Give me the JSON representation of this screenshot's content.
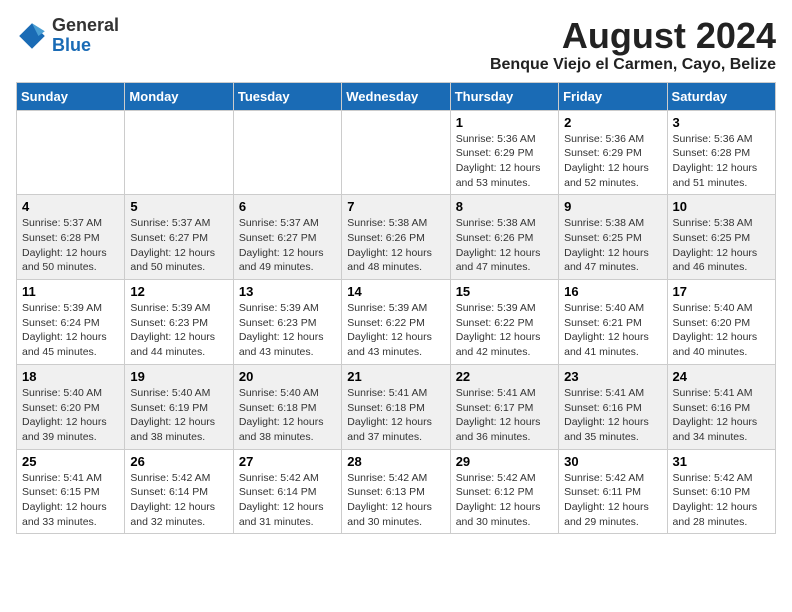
{
  "logo": {
    "text_general": "General",
    "text_blue": "Blue"
  },
  "title": {
    "month_year": "August 2024",
    "location": "Benque Viejo el Carmen, Cayo, Belize"
  },
  "headers": [
    "Sunday",
    "Monday",
    "Tuesday",
    "Wednesday",
    "Thursday",
    "Friday",
    "Saturday"
  ],
  "weeks": [
    [
      {
        "day": "",
        "info": ""
      },
      {
        "day": "",
        "info": ""
      },
      {
        "day": "",
        "info": ""
      },
      {
        "day": "",
        "info": ""
      },
      {
        "day": "1",
        "info": "Sunrise: 5:36 AM\nSunset: 6:29 PM\nDaylight: 12 hours\nand 53 minutes."
      },
      {
        "day": "2",
        "info": "Sunrise: 5:36 AM\nSunset: 6:29 PM\nDaylight: 12 hours\nand 52 minutes."
      },
      {
        "day": "3",
        "info": "Sunrise: 5:36 AM\nSunset: 6:28 PM\nDaylight: 12 hours\nand 51 minutes."
      }
    ],
    [
      {
        "day": "4",
        "info": "Sunrise: 5:37 AM\nSunset: 6:28 PM\nDaylight: 12 hours\nand 50 minutes."
      },
      {
        "day": "5",
        "info": "Sunrise: 5:37 AM\nSunset: 6:27 PM\nDaylight: 12 hours\nand 50 minutes."
      },
      {
        "day": "6",
        "info": "Sunrise: 5:37 AM\nSunset: 6:27 PM\nDaylight: 12 hours\nand 49 minutes."
      },
      {
        "day": "7",
        "info": "Sunrise: 5:38 AM\nSunset: 6:26 PM\nDaylight: 12 hours\nand 48 minutes."
      },
      {
        "day": "8",
        "info": "Sunrise: 5:38 AM\nSunset: 6:26 PM\nDaylight: 12 hours\nand 47 minutes."
      },
      {
        "day": "9",
        "info": "Sunrise: 5:38 AM\nSunset: 6:25 PM\nDaylight: 12 hours\nand 47 minutes."
      },
      {
        "day": "10",
        "info": "Sunrise: 5:38 AM\nSunset: 6:25 PM\nDaylight: 12 hours\nand 46 minutes."
      }
    ],
    [
      {
        "day": "11",
        "info": "Sunrise: 5:39 AM\nSunset: 6:24 PM\nDaylight: 12 hours\nand 45 minutes."
      },
      {
        "day": "12",
        "info": "Sunrise: 5:39 AM\nSunset: 6:23 PM\nDaylight: 12 hours\nand 44 minutes."
      },
      {
        "day": "13",
        "info": "Sunrise: 5:39 AM\nSunset: 6:23 PM\nDaylight: 12 hours\nand 43 minutes."
      },
      {
        "day": "14",
        "info": "Sunrise: 5:39 AM\nSunset: 6:22 PM\nDaylight: 12 hours\nand 43 minutes."
      },
      {
        "day": "15",
        "info": "Sunrise: 5:39 AM\nSunset: 6:22 PM\nDaylight: 12 hours\nand 42 minutes."
      },
      {
        "day": "16",
        "info": "Sunrise: 5:40 AM\nSunset: 6:21 PM\nDaylight: 12 hours\nand 41 minutes."
      },
      {
        "day": "17",
        "info": "Sunrise: 5:40 AM\nSunset: 6:20 PM\nDaylight: 12 hours\nand 40 minutes."
      }
    ],
    [
      {
        "day": "18",
        "info": "Sunrise: 5:40 AM\nSunset: 6:20 PM\nDaylight: 12 hours\nand 39 minutes."
      },
      {
        "day": "19",
        "info": "Sunrise: 5:40 AM\nSunset: 6:19 PM\nDaylight: 12 hours\nand 38 minutes."
      },
      {
        "day": "20",
        "info": "Sunrise: 5:40 AM\nSunset: 6:18 PM\nDaylight: 12 hours\nand 38 minutes."
      },
      {
        "day": "21",
        "info": "Sunrise: 5:41 AM\nSunset: 6:18 PM\nDaylight: 12 hours\nand 37 minutes."
      },
      {
        "day": "22",
        "info": "Sunrise: 5:41 AM\nSunset: 6:17 PM\nDaylight: 12 hours\nand 36 minutes."
      },
      {
        "day": "23",
        "info": "Sunrise: 5:41 AM\nSunset: 6:16 PM\nDaylight: 12 hours\nand 35 minutes."
      },
      {
        "day": "24",
        "info": "Sunrise: 5:41 AM\nSunset: 6:16 PM\nDaylight: 12 hours\nand 34 minutes."
      }
    ],
    [
      {
        "day": "25",
        "info": "Sunrise: 5:41 AM\nSunset: 6:15 PM\nDaylight: 12 hours\nand 33 minutes."
      },
      {
        "day": "26",
        "info": "Sunrise: 5:42 AM\nSunset: 6:14 PM\nDaylight: 12 hours\nand 32 minutes."
      },
      {
        "day": "27",
        "info": "Sunrise: 5:42 AM\nSunset: 6:14 PM\nDaylight: 12 hours\nand 31 minutes."
      },
      {
        "day": "28",
        "info": "Sunrise: 5:42 AM\nSunset: 6:13 PM\nDaylight: 12 hours\nand 30 minutes."
      },
      {
        "day": "29",
        "info": "Sunrise: 5:42 AM\nSunset: 6:12 PM\nDaylight: 12 hours\nand 30 minutes."
      },
      {
        "day": "30",
        "info": "Sunrise: 5:42 AM\nSunset: 6:11 PM\nDaylight: 12 hours\nand 29 minutes."
      },
      {
        "day": "31",
        "info": "Sunrise: 5:42 AM\nSunset: 6:10 PM\nDaylight: 12 hours\nand 28 minutes."
      }
    ]
  ]
}
